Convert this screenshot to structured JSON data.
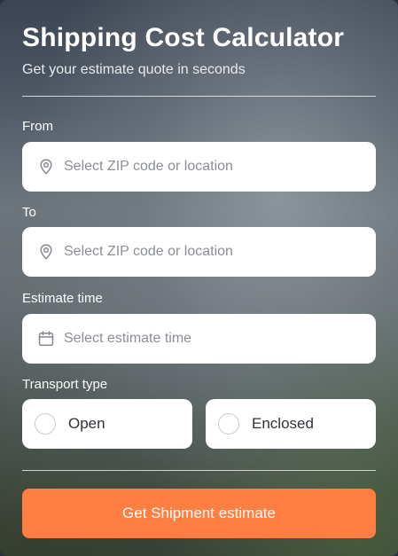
{
  "header": {
    "title": "Shipping Cost Calculator",
    "subtitle": "Get your estimate quote in seconds"
  },
  "form": {
    "from": {
      "label": "From",
      "placeholder": "Select ZIP code or location",
      "icon": "location-pin-icon"
    },
    "to": {
      "label": "To",
      "placeholder": "Select ZIP code or location",
      "icon": "location-pin-icon"
    },
    "estimate_time": {
      "label": "Estimate time",
      "placeholder": "Select estimate time",
      "icon": "calendar-icon"
    },
    "transport_type": {
      "label": "Transport type",
      "options": [
        {
          "label": "Open",
          "selected": false
        },
        {
          "label": "Enclosed",
          "selected": false
        }
      ]
    },
    "submit_label": "Get Shipment estimate"
  },
  "colors": {
    "accent": "#ff7e42",
    "field_bg": "#ffffff",
    "placeholder": "#8b8f95",
    "icon": "#8b8f95"
  }
}
